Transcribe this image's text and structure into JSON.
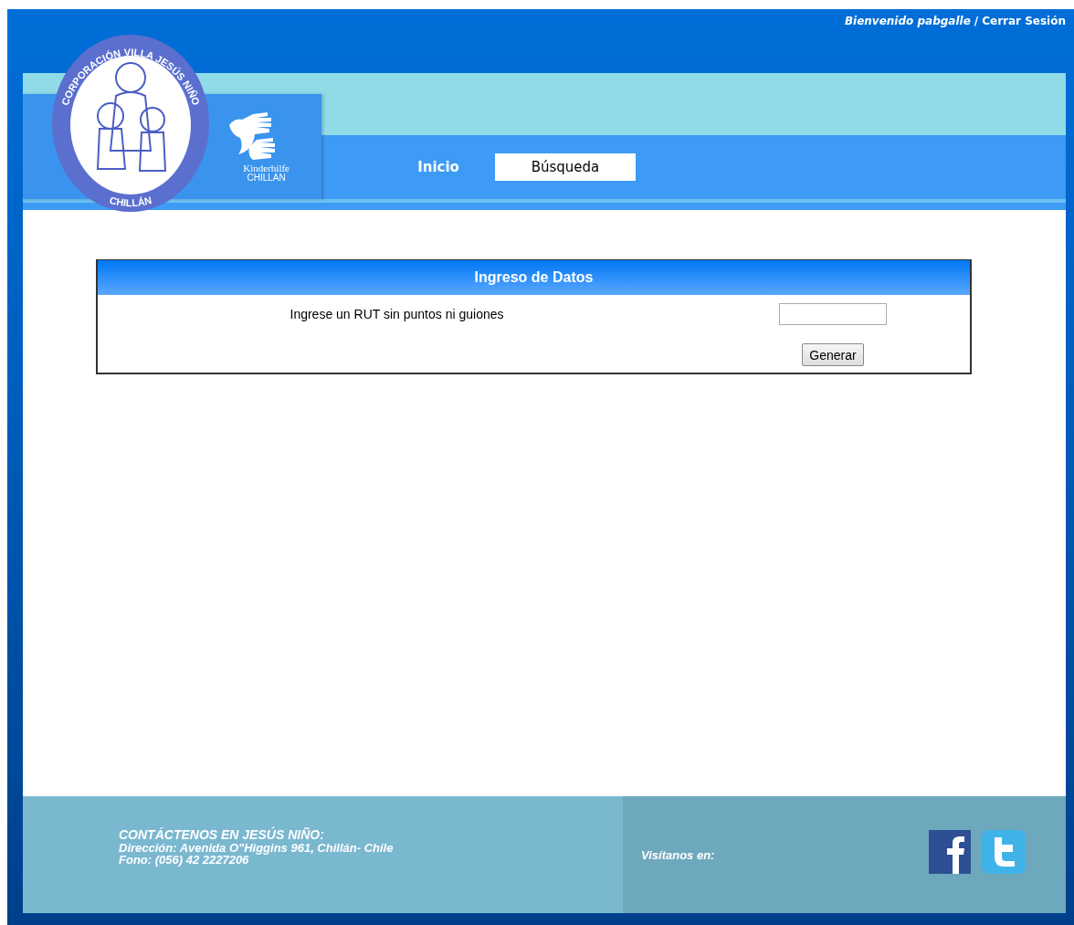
{
  "header": {
    "welcome": "Bienvenido pabgalle",
    "separator": "/",
    "logout": "Cerrar Sesión",
    "logo": {
      "arc_text": "CORPORACIÓN VILLA JESÚS NIÑO",
      "bottom_text": "CHILLÁN"
    },
    "partner": {
      "name": "Kinderhilfe",
      "city": "CHILLAN"
    }
  },
  "nav": [
    {
      "label": "Inicio",
      "selected": false
    },
    {
      "label": "Búsqueda",
      "selected": true
    }
  ],
  "form": {
    "title": "Ingreso de Datos",
    "prompt": "Ingrese un RUT sin puntos ni guiones",
    "button": "Generar"
  },
  "footer": {
    "contact_title": "CONTÁCTENOS EN JESÚS NIÑO:",
    "address": "Dirección: Avenida O\"Higgins 961, Chillán- Chile",
    "phone": "Fono: (056) 42 2227206",
    "social_label": "Visítanos en:"
  }
}
